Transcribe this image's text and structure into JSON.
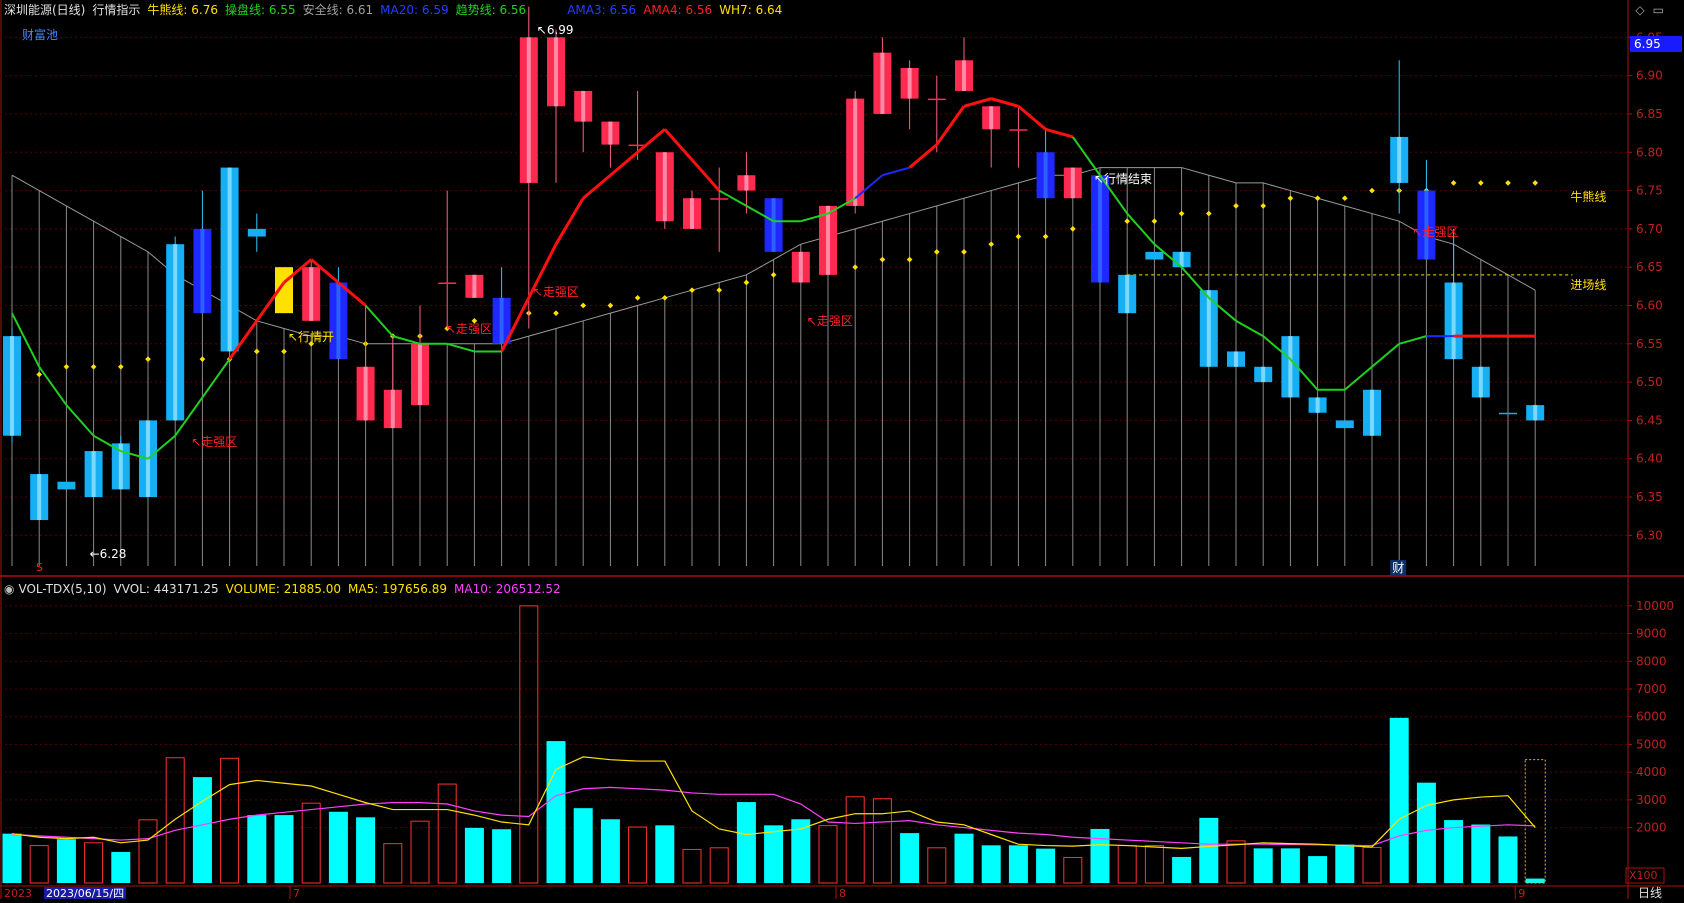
{
  "header": {
    "stock_name": "深圳能源(日线)",
    "indicator_name": "行情指示",
    "bull_bear_label": "牛熊线:",
    "bull_bear_value": "6.76",
    "operation_label": "操盘线:",
    "operation_value": "6.55",
    "safety_label": "安全线:",
    "safety_value": "6.61",
    "ma20_label": "MA20:",
    "ma20_value": "6.59",
    "trend_label": "趋势线:",
    "trend_value": "6.56",
    "ama3_label": "AMA3:",
    "ama3_value": "6.56",
    "ama4_label": "AMA4:",
    "ama4_value": "6.56",
    "wh7_label": "WH7:",
    "wh7_value": "6.64",
    "pool_label": "财富池",
    "price_box": "6.95"
  },
  "vol_header": {
    "name": "VOL-TDX(5,10)",
    "vvol_label": "VVOL:",
    "vvol_value": "443171.25",
    "volume_label": "VOLUME:",
    "volume_value": "21885.00",
    "ma5_label": "MA5:",
    "ma5_value": "197656.89",
    "ma10_label": "MA10:",
    "ma10_value": "206512.52"
  },
  "bottom": {
    "date_prefix": "2023",
    "date_current": "2023/06/15/四",
    "month_labels": [
      "7",
      "8",
      "9"
    ],
    "period_label": "日线",
    "unit_label": "X100"
  },
  "annotations": {
    "high_value": "6.99",
    "low_value": "6.28",
    "strong_zone": "走强区",
    "start_label": "行情开",
    "end_label": "行情结束",
    "bull_line_label": "牛熊线",
    "entry_line_label": "进场线",
    "s_marker": "S",
    "cai_marker": "财"
  },
  "colors": {
    "up": "#ff2a50",
    "down_cyan": "#16aff3",
    "down_blue": "#1e28ff",
    "vol_cyan": "#00ffff",
    "ma_red": "#ff1010",
    "ma_green": "#20d020",
    "yellow": "#ffe000",
    "magenta": "#ff40ff"
  },
  "chart_data": [
    {
      "type": "candlestick",
      "y_axis_ticks": [
        6.3,
        6.35,
        6.4,
        6.45,
        6.5,
        6.55,
        6.6,
        6.65,
        6.7,
        6.75,
        6.8,
        6.85,
        6.9,
        6.95
      ],
      "ylim": [
        6.26,
        6.97
      ],
      "candles": [
        {
          "o": 6.56,
          "c": 6.43,
          "h": 6.57,
          "l": 6.42,
          "col": "cyan"
        },
        {
          "o": 6.38,
          "c": 6.32,
          "h": 6.38,
          "l": 6.32,
          "col": "cyan"
        },
        {
          "o": 6.37,
          "c": 6.36,
          "h": 6.37,
          "l": 6.36,
          "col": "cyan"
        },
        {
          "o": 6.41,
          "c": 6.35,
          "h": 6.41,
          "l": 6.35,
          "col": "cyan"
        },
        {
          "o": 6.42,
          "c": 6.36,
          "h": 6.43,
          "l": 6.36,
          "col": "cyan"
        },
        {
          "o": 6.45,
          "c": 6.35,
          "h": 6.45,
          "l": 6.35,
          "col": "cyan"
        },
        {
          "o": 6.68,
          "c": 6.45,
          "h": 6.69,
          "l": 6.45,
          "col": "cyan"
        },
        {
          "o": 6.7,
          "c": 6.59,
          "h": 6.75,
          "l": 6.59,
          "col": "blue"
        },
        {
          "o": 6.78,
          "c": 6.54,
          "h": 6.78,
          "l": 6.54,
          "col": "cyan"
        },
        {
          "o": 6.7,
          "c": 6.69,
          "h": 6.72,
          "l": 6.67,
          "col": "cyan"
        },
        {
          "o": 6.59,
          "c": 6.65,
          "h": 6.65,
          "l": 6.59,
          "col": "yellow"
        },
        {
          "o": 6.58,
          "c": 6.65,
          "h": 6.66,
          "l": 6.58,
          "col": "red"
        },
        {
          "o": 6.63,
          "c": 6.53,
          "h": 6.65,
          "l": 6.53,
          "col": "blue"
        },
        {
          "o": 6.45,
          "c": 6.52,
          "h": 6.6,
          "l": 6.45,
          "col": "red"
        },
        {
          "o": 6.44,
          "c": 6.49,
          "h": 6.56,
          "l": 6.44,
          "col": "red"
        },
        {
          "o": 6.47,
          "c": 6.55,
          "h": 6.6,
          "l": 6.47,
          "col": "red"
        },
        {
          "o": 6.63,
          "c": 6.63,
          "h": 6.75,
          "l": 6.57,
          "col": "red"
        },
        {
          "o": 6.61,
          "c": 6.64,
          "h": 6.64,
          "l": 6.61,
          "col": "red"
        },
        {
          "o": 6.61,
          "c": 6.55,
          "h": 6.65,
          "l": 6.55,
          "col": "blue"
        },
        {
          "o": 6.76,
          "c": 6.95,
          "h": 6.99,
          "l": 6.57,
          "col": "red"
        },
        {
          "o": 6.86,
          "c": 6.95,
          "h": 6.96,
          "l": 6.76,
          "col": "red"
        },
        {
          "o": 6.84,
          "c": 6.88,
          "h": 6.88,
          "l": 6.8,
          "col": "red"
        },
        {
          "o": 6.81,
          "c": 6.84,
          "h": 6.84,
          "l": 6.78,
          "col": "red"
        },
        {
          "o": 6.81,
          "c": 6.81,
          "h": 6.88,
          "l": 6.79,
          "col": "red"
        },
        {
          "o": 6.71,
          "c": 6.8,
          "h": 6.8,
          "l": 6.7,
          "col": "red"
        },
        {
          "o": 6.7,
          "c": 6.74,
          "h": 6.75,
          "l": 6.7,
          "col": "red"
        },
        {
          "o": 6.74,
          "c": 6.74,
          "h": 6.78,
          "l": 6.67,
          "col": "red"
        },
        {
          "o": 6.75,
          "c": 6.77,
          "h": 6.8,
          "l": 6.72,
          "col": "red"
        },
        {
          "o": 6.74,
          "c": 6.67,
          "h": 6.74,
          "l": 6.67,
          "col": "blue"
        },
        {
          "o": 6.63,
          "c": 6.67,
          "h": 6.67,
          "l": 6.63,
          "col": "red"
        },
        {
          "o": 6.64,
          "c": 6.73,
          "h": 6.73,
          "l": 6.64,
          "col": "red"
        },
        {
          "o": 6.73,
          "c": 6.87,
          "h": 6.88,
          "l": 6.72,
          "col": "red"
        },
        {
          "o": 6.85,
          "c": 6.93,
          "h": 6.95,
          "l": 6.85,
          "col": "red"
        },
        {
          "o": 6.87,
          "c": 6.91,
          "h": 6.92,
          "l": 6.83,
          "col": "red"
        },
        {
          "o": 6.87,
          "c": 6.87,
          "h": 6.9,
          "l": 6.8,
          "col": "red"
        },
        {
          "o": 6.88,
          "c": 6.92,
          "h": 6.95,
          "l": 6.88,
          "col": "red"
        },
        {
          "o": 6.83,
          "c": 6.86,
          "h": 6.86,
          "l": 6.78,
          "col": "red"
        },
        {
          "o": 6.83,
          "c": 6.83,
          "h": 6.86,
          "l": 6.78,
          "col": "red"
        },
        {
          "o": 6.8,
          "c": 6.74,
          "h": 6.83,
          "l": 6.74,
          "col": "blue"
        },
        {
          "o": 6.74,
          "c": 6.78,
          "h": 6.78,
          "l": 6.74,
          "col": "red"
        },
        {
          "o": 6.77,
          "c": 6.63,
          "h": 6.77,
          "l": 6.63,
          "col": "blue"
        },
        {
          "o": 6.64,
          "c": 6.59,
          "h": 6.64,
          "l": 6.59,
          "col": "cyan"
        },
        {
          "o": 6.67,
          "c": 6.66,
          "h": 6.67,
          "l": 6.66,
          "col": "cyan"
        },
        {
          "o": 6.67,
          "c": 6.65,
          "h": 6.67,
          "l": 6.65,
          "col": "cyan"
        },
        {
          "o": 6.62,
          "c": 6.52,
          "h": 6.62,
          "l": 6.52,
          "col": "cyan"
        },
        {
          "o": 6.54,
          "c": 6.52,
          "h": 6.54,
          "l": 6.52,
          "col": "cyan"
        },
        {
          "o": 6.52,
          "c": 6.5,
          "h": 6.52,
          "l": 6.5,
          "col": "cyan"
        },
        {
          "o": 6.56,
          "c": 6.48,
          "h": 6.56,
          "l": 6.48,
          "col": "cyan"
        },
        {
          "o": 6.48,
          "c": 6.46,
          "h": 6.48,
          "l": 6.46,
          "col": "cyan"
        },
        {
          "o": 6.45,
          "c": 6.44,
          "h": 6.45,
          "l": 6.44,
          "col": "cyan"
        },
        {
          "o": 6.49,
          "c": 6.43,
          "h": 6.49,
          "l": 6.43,
          "col": "cyan"
        },
        {
          "o": 6.82,
          "c": 6.76,
          "h": 6.92,
          "l": 6.72,
          "col": "cyan"
        },
        {
          "o": 6.75,
          "c": 6.66,
          "h": 6.79,
          "l": 6.66,
          "col": "blue"
        },
        {
          "o": 6.63,
          "c": 6.53,
          "h": 6.7,
          "l": 6.53,
          "col": "cyan"
        },
        {
          "o": 6.52,
          "c": 6.48,
          "h": 6.52,
          "l": 6.48,
          "col": "cyan"
        },
        {
          "o": 6.46,
          "c": 6.46,
          "h": 6.46,
          "l": 6.46,
          "col": "cyan"
        },
        {
          "o": 6.47,
          "c": 6.45,
          "h": 6.47,
          "l": 6.45,
          "col": "cyan"
        }
      ],
      "trend_line": [
        6.59,
        6.52,
        6.47,
        6.43,
        6.41,
        6.4,
        6.43,
        6.48,
        6.53,
        6.58,
        6.63,
        6.66,
        6.63,
        6.6,
        6.56,
        6.55,
        6.55,
        6.54,
        6.54,
        6.61,
        6.68,
        6.74,
        6.77,
        6.8,
        6.83,
        6.79,
        6.75,
        6.73,
        6.71,
        6.71,
        6.72,
        6.74,
        6.77,
        6.78,
        6.81,
        6.86,
        6.87,
        6.86,
        6.83,
        6.82,
        6.77,
        6.72,
        6.68,
        6.65,
        6.61,
        6.58,
        6.56,
        6.53,
        6.49,
        6.49,
        6.52,
        6.55,
        6.56,
        6.56,
        6.56,
        6.56,
        6.56
      ],
      "trend_colors": [
        "g",
        "g",
        "g",
        "g",
        "g",
        "g",
        "g",
        "g",
        "g",
        "r",
        "r",
        "r",
        "r",
        "r",
        "g",
        "g",
        "g",
        "g",
        "g",
        "r",
        "r",
        "r",
        "r",
        "r",
        "r",
        "r",
        "r",
        "g",
        "g",
        "g",
        "g",
        "g",
        "b",
        "b",
        "r",
        "r",
        "r",
        "r",
        "r",
        "r",
        "g",
        "g",
        "g",
        "g",
        "g",
        "g",
        "g",
        "g",
        "g",
        "g",
        "g",
        "g",
        "g",
        "b",
        "r",
        "r",
        "r"
      ],
      "gray_ma": [
        6.77,
        6.75,
        6.73,
        6.71,
        6.69,
        6.67,
        6.64,
        6.62,
        6.6,
        6.58,
        6.57,
        6.56,
        6.56,
        6.55,
        6.55,
        6.55,
        6.55,
        6.55,
        6.55,
        6.56,
        6.57,
        6.58,
        6.59,
        6.6,
        6.61,
        6.62,
        6.63,
        6.64,
        6.66,
        6.68,
        6.69,
        6.7,
        6.71,
        6.72,
        6.73,
        6.74,
        6.75,
        6.76,
        6.77,
        6.77,
        6.78,
        6.78,
        6.78,
        6.78,
        6.77,
        6.76,
        6.76,
        6.75,
        6.74,
        6.73,
        6.72,
        6.71,
        6.69,
        6.68,
        6.66,
        6.64,
        6.62
      ],
      "yellow_dots": [
        6.51,
        6.51,
        6.52,
        6.52,
        6.52,
        6.53,
        6.53,
        6.53,
        6.53,
        6.54,
        6.54,
        6.55,
        6.55,
        6.55,
        6.56,
        6.56,
        6.57,
        6.58,
        6.58,
        6.59,
        6.59,
        6.6,
        6.6,
        6.61,
        6.61,
        6.62,
        6.62,
        6.63,
        6.64,
        6.64,
        6.65,
        6.65,
        6.66,
        6.66,
        6.67,
        6.67,
        6.68,
        6.69,
        6.69,
        6.7,
        6.7,
        6.71,
        6.71,
        6.72,
        6.72,
        6.73,
        6.73,
        6.74,
        6.74,
        6.74,
        6.75,
        6.75,
        6.75,
        6.76,
        6.76,
        6.76,
        6.76
      ],
      "entry_line": 6.64
    },
    {
      "type": "bar",
      "title": "VOL-TDX(5,10)",
      "y_axis_ticks": [
        2000,
        3000,
        4000,
        5000,
        6000,
        7000,
        8000,
        9000,
        10000
      ],
      "ylim": [
        0,
        10500
      ],
      "volumes": [
        1780,
        1350,
        1580,
        1450,
        1120,
        2280,
        4520,
        3820,
        4500,
        2450,
        2450,
        2880,
        2570,
        2370,
        1420,
        2230,
        3570,
        1990,
        1940,
        10000,
        5120,
        2700,
        2300,
        2020,
        2080,
        1210,
        1270,
        2920,
        2080,
        2300,
        2070,
        3110,
        3040,
        1800,
        1270,
        1780,
        1360,
        1360,
        1240,
        920,
        1950,
        1350,
        1350,
        940,
        2350,
        1520,
        1250,
        1250,
        970,
        1390,
        1280,
        5960,
        3620,
        2270,
        2110,
        1680,
        160
      ],
      "vol_col": [
        "c",
        "r",
        "c",
        "r",
        "c",
        "r",
        "r",
        "c",
        "r",
        "c",
        "c",
        "r",
        "c",
        "c",
        "r",
        "r",
        "r",
        "c",
        "c",
        "r",
        "c",
        "c",
        "c",
        "r",
        "c",
        "r",
        "r",
        "c",
        "c",
        "c",
        "r",
        "r",
        "r",
        "c",
        "r",
        "c",
        "c",
        "c",
        "c",
        "r",
        "c",
        "r",
        "r",
        "c",
        "c",
        "r",
        "c",
        "c",
        "c",
        "c",
        "r",
        "c",
        "c",
        "c",
        "c",
        "c",
        "c"
      ],
      "ma5": [
        1780,
        1650,
        1600,
        1650,
        1450,
        1550,
        2300,
        2950,
        3550,
        3700,
        3600,
        3500,
        3200,
        2900,
        2650,
        2650,
        2650,
        2450,
        2200,
        2100,
        4100,
        4550,
        4450,
        4400,
        4400,
        2600,
        1950,
        1750,
        1850,
        1950,
        2300,
        2500,
        2500,
        2600,
        2200,
        2100,
        1750,
        1400,
        1350,
        1330,
        1380,
        1350,
        1300,
        1250,
        1320,
        1380,
        1450,
        1420,
        1400,
        1350,
        1300,
        2300,
        2800,
        3000,
        3100,
        3150,
        2000
      ],
      "ma10": [
        1750,
        1700,
        1650,
        1600,
        1550,
        1600,
        1900,
        2100,
        2300,
        2450,
        2550,
        2650,
        2750,
        2850,
        2900,
        2900,
        2850,
        2600,
        2450,
        2400,
        3150,
        3400,
        3450,
        3400,
        3350,
        3250,
        3200,
        3200,
        3200,
        2850,
        2200,
        2150,
        2200,
        2250,
        2100,
        2000,
        1900,
        1800,
        1750,
        1650,
        1600,
        1550,
        1500,
        1450,
        1400,
        1400,
        1400,
        1390,
        1380,
        1360,
        1350,
        1700,
        1900,
        2000,
        2050,
        2100,
        2060
      ]
    }
  ]
}
